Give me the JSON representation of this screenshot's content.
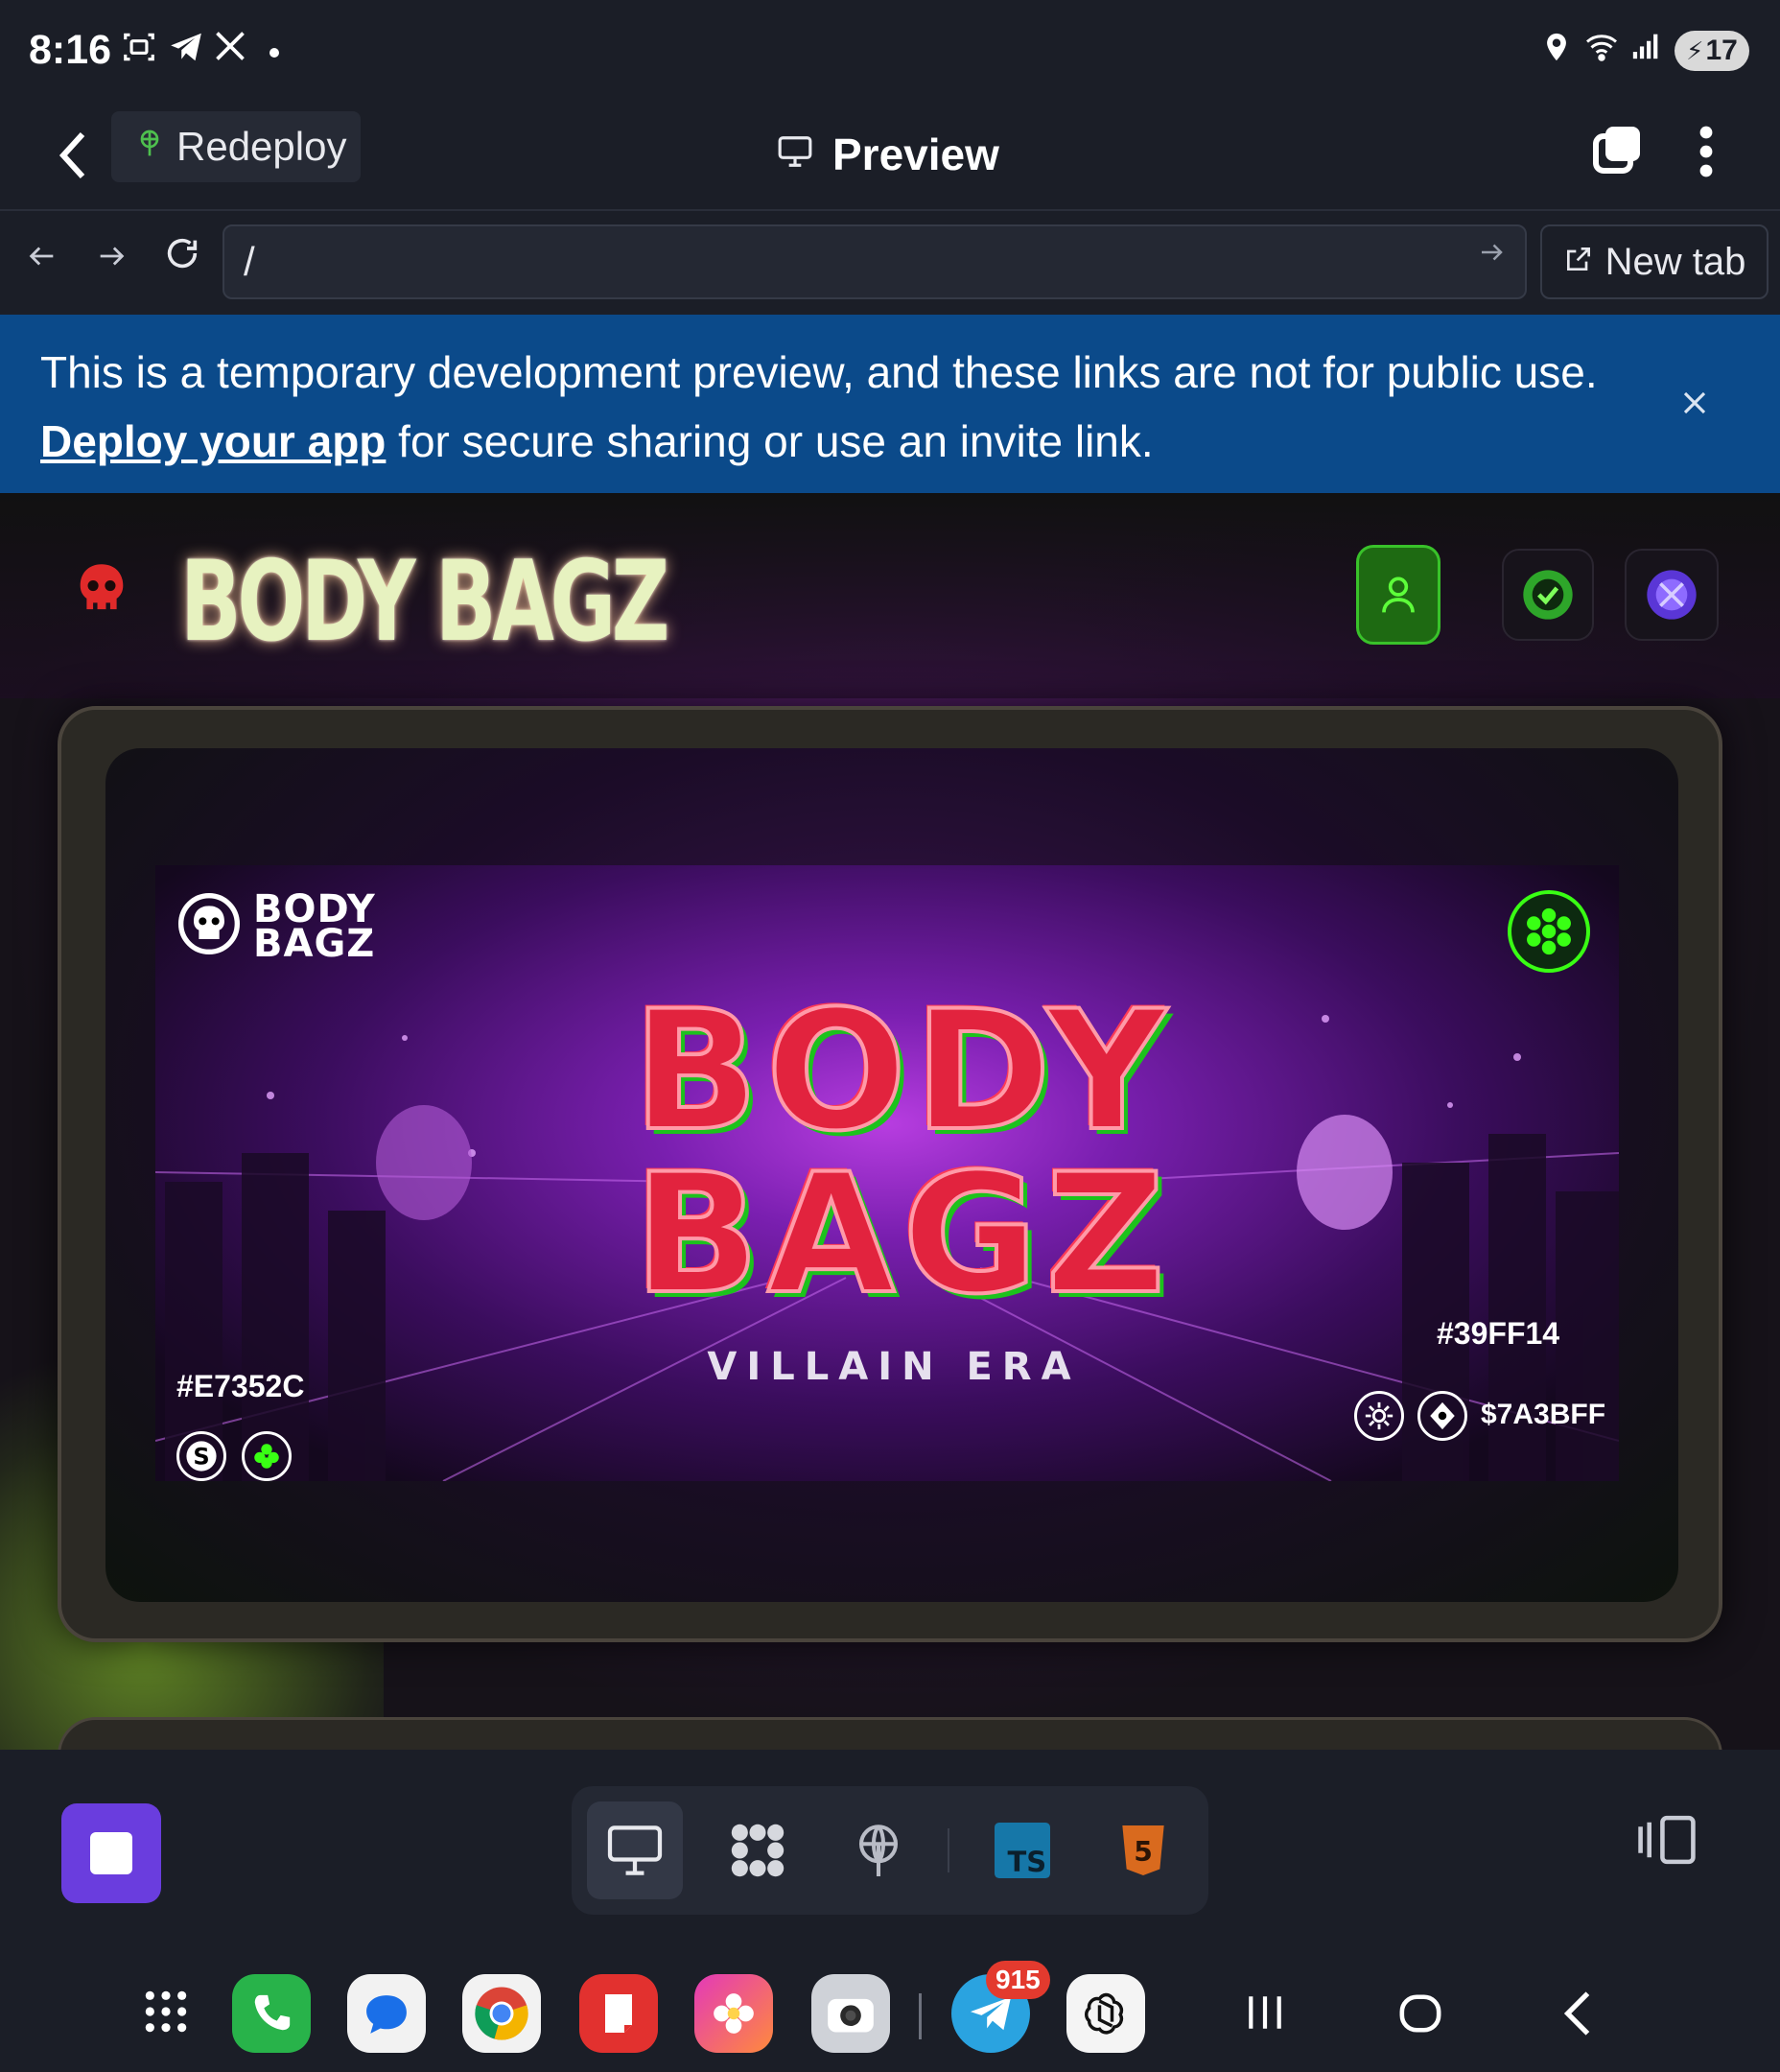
{
  "status_bar": {
    "time": "8:16",
    "battery": "17",
    "icons": [
      "screenshot-icon",
      "telegram-icon",
      "x-icon",
      "dot-icon",
      "location-icon",
      "wifi-icon",
      "signal-icon",
      "battery-icon"
    ]
  },
  "app_header": {
    "redeploy_label": "Redeploy",
    "title": "Preview"
  },
  "url_bar": {
    "value": "/",
    "new_tab_label": "New tab"
  },
  "banner": {
    "text_before": "This is a temporary development preview, and these links are not for public use. ",
    "link": "Deploy your app",
    "text_after": " for secure sharing or use an invite link."
  },
  "site": {
    "brand_title": "BODY BAGZ",
    "card": {
      "mini_logo_line1": "BODY",
      "mini_logo_line2": "BAGZ",
      "title_line1": "BODY",
      "title_line2": "BAGZ",
      "tagline": "VILLAIN ERA",
      "color_left": "#E7352C",
      "color_right": "#39FF14",
      "token_label": "$7A3BFF"
    }
  },
  "dock": {
    "telegram_badge": "915"
  },
  "colors": {
    "accent_purple": "#6a3dde",
    "banner_blue": "#0b4a8a",
    "neon_green": "#39ff14",
    "brand_red": "#e2233e"
  }
}
